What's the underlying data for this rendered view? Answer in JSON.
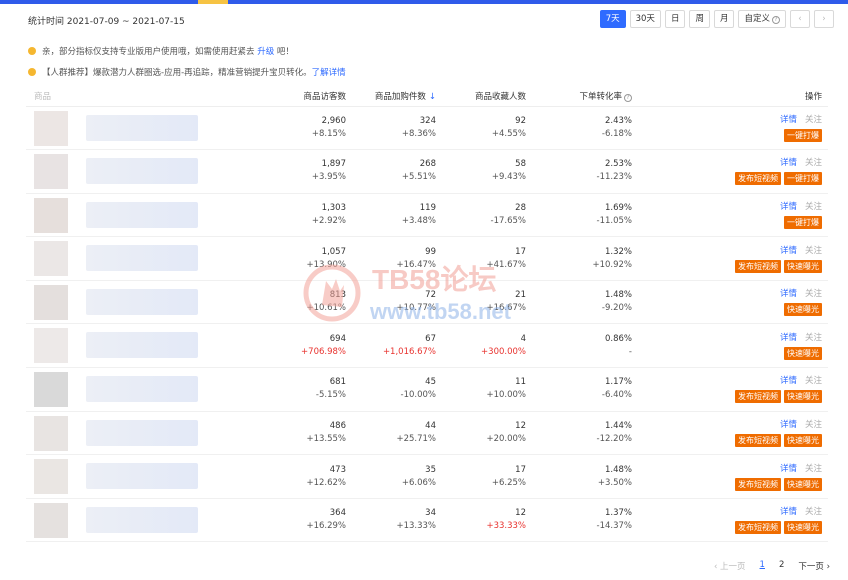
{
  "header": {
    "stat_time": "统计时间 2021-07-09 ~ 2021-07-15",
    "ranges": [
      "7天",
      "30天",
      "日",
      "周",
      "月",
      "自定义"
    ],
    "prev": "‹",
    "next": "›"
  },
  "notices": [
    {
      "text": "亲，部分指标仅支持专业版用户使用哦，如需使用赶紧去 ",
      "link": "升级",
      "suffix": " 吧！"
    },
    {
      "text": "【人群推荐】爆款潜力人群圈选-应用-再追踪，精准营销提升宝贝转化。",
      "link": "了解详情",
      "suffix": ""
    }
  ],
  "table": {
    "headers": {
      "product": "商品",
      "visitors": "商品访客数",
      "cart": "商品加购件数",
      "fav": "商品收藏人数",
      "conv": "下单转化率",
      "ops": "操作"
    },
    "sort_icon": "↓",
    "detail_label": "详情",
    "follow_label": "关注",
    "rows": [
      {
        "visitors": "2,960",
        "visitors_c": "+8.15%",
        "cart": "324",
        "cart_c": "+8.36%",
        "fav": "92",
        "fav_c": "+4.55%",
        "conv": "2.43%",
        "conv_c": "-6.18%",
        "buttons": [
          "一键打爆"
        ]
      },
      {
        "visitors": "1,897",
        "visitors_c": "+3.95%",
        "cart": "268",
        "cart_c": "+5.51%",
        "fav": "58",
        "fav_c": "+9.43%",
        "conv": "2.53%",
        "conv_c": "-11.23%",
        "buttons": [
          "发布短视频",
          "一键打爆"
        ]
      },
      {
        "visitors": "1,303",
        "visitors_c": "+2.92%",
        "cart": "119",
        "cart_c": "+3.48%",
        "fav": "28",
        "fav_c": "-17.65%",
        "conv": "1.69%",
        "conv_c": "-11.05%",
        "buttons": [
          "一键打爆"
        ]
      },
      {
        "visitors": "1,057",
        "visitors_c": "+13.90%",
        "cart": "99",
        "cart_c": "+16.47%",
        "fav": "17",
        "fav_c": "+41.67%",
        "conv": "1.32%",
        "conv_c": "+10.92%",
        "buttons": [
          "发布短视频",
          "快速曝光"
        ]
      },
      {
        "visitors": "813",
        "visitors_c": "+10.61%",
        "cart": "72",
        "cart_c": "+10.77%",
        "fav": "21",
        "fav_c": "+16.67%",
        "conv": "1.48%",
        "conv_c": "-9.20%",
        "buttons": [
          "快速曝光"
        ]
      },
      {
        "visitors": "694",
        "visitors_c": "+706.98%",
        "cart": "67",
        "cart_c": "+1,016.67%",
        "fav": "4",
        "fav_c": "+300.00%",
        "conv": "0.86%",
        "conv_c": "-",
        "buttons": [
          "快速曝光"
        ],
        "red": true
      },
      {
        "visitors": "681",
        "visitors_c": "-5.15%",
        "cart": "45",
        "cart_c": "-10.00%",
        "fav": "11",
        "fav_c": "+10.00%",
        "conv": "1.17%",
        "conv_c": "-6.40%",
        "buttons": [
          "发布短视频",
          "快速曝光"
        ]
      },
      {
        "visitors": "486",
        "visitors_c": "+13.55%",
        "cart": "44",
        "cart_c": "+25.71%",
        "fav": "12",
        "fav_c": "+20.00%",
        "conv": "1.44%",
        "conv_c": "-12.20%",
        "buttons": [
          "发布短视频",
          "快速曝光"
        ]
      },
      {
        "visitors": "473",
        "visitors_c": "+12.62%",
        "cart": "35",
        "cart_c": "+6.06%",
        "fav": "17",
        "fav_c": "+6.25%",
        "conv": "1.48%",
        "conv_c": "+3.50%",
        "buttons": [
          "发布短视频",
          "快速曝光"
        ]
      },
      {
        "visitors": "364",
        "visitors_c": "+16.29%",
        "cart": "34",
        "cart_c": "+13.33%",
        "fav": "12",
        "fav_c": "+33.33%",
        "conv": "1.37%",
        "conv_c": "-14.37%",
        "buttons": [
          "发布短视频",
          "快速曝光"
        ],
        "red_fav": true
      }
    ]
  },
  "pager": {
    "prev": "‹ 上一页",
    "pages": [
      "1",
      "2"
    ],
    "current": "1",
    "next": "下一页 ›"
  },
  "watermark": {
    "line1": "TB58论坛",
    "line2": "www.tb58.net"
  },
  "colors": {
    "accent": "#2f6bff",
    "action": "#ef6c00",
    "negative": "#e8322e"
  }
}
